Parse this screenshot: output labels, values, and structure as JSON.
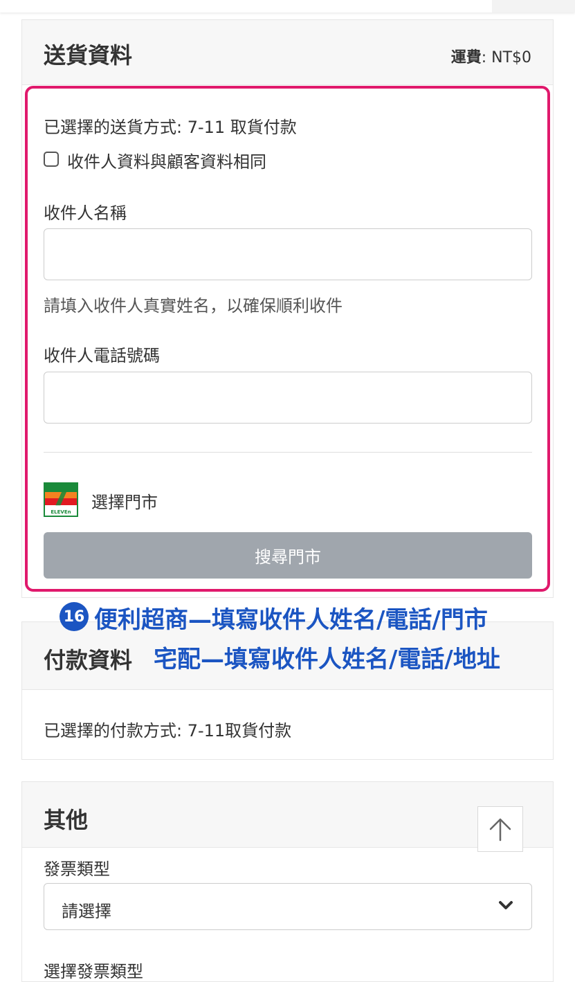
{
  "shipping": {
    "title": "送貨資料",
    "fee_label": "運費",
    "fee_value": ": NT$0",
    "selected_method": "已選擇的送貨方式: 7-11 取貨付款",
    "same_as_customer_label": "收件人資料與顧客資料相同",
    "recipient_name_label": "收件人名稱",
    "recipient_name_value": "",
    "recipient_name_hint": "請填入收件人真實姓名，以確保順利收件",
    "recipient_phone_label": "收件人電話號碼",
    "recipient_phone_value": "",
    "choose_store_label": "選擇門市",
    "search_store_button": "搜尋門市",
    "logo_number": "7",
    "logo_text": "ELEVEn"
  },
  "annotation": {
    "badge": "16",
    "line1": "便利超商—填寫收件人姓名/電話/門市",
    "line2": "宅配—填寫收件人姓名/電話/地址",
    "color": "#1b55c2"
  },
  "payment": {
    "title": "付款資料",
    "selected_method": "已選擇的付款方式: 7-11取貨付款"
  },
  "other": {
    "title": "其他",
    "invoice_type_label": "發票類型",
    "invoice_type_value": "請選擇",
    "next_label_partial": "選擇發票類型"
  },
  "colors": {
    "highlight": "#e0196c",
    "button_disabled": "#a0a6ad",
    "header_bg": "#f7f7f7"
  },
  "icons": {
    "back_to_top": "arrow-up-icon",
    "select_arrow": "chevron-down-icon",
    "store_logo": "seven-eleven-logo-icon"
  }
}
